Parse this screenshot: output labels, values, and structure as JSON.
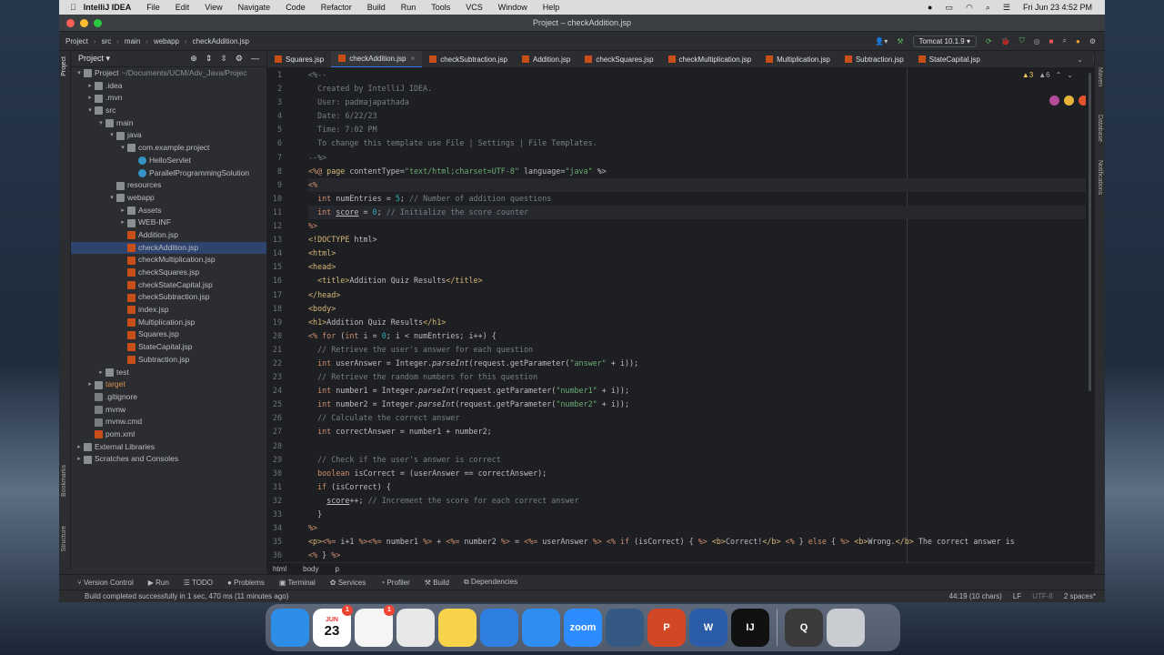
{
  "menubar": {
    "app": "IntelliJ IDEA",
    "items": [
      "File",
      "Edit",
      "View",
      "Navigate",
      "Code",
      "Refactor",
      "Build",
      "Run",
      "Tools",
      "VCS",
      "Window",
      "Help"
    ],
    "clock": "Fri Jun 23  4:52 PM"
  },
  "window_title": "Project – checkAddition.jsp",
  "breadcrumbs": [
    "Project",
    "src",
    "main",
    "webapp",
    "checkAddition.jsp"
  ],
  "run_config": "Tomcat 10.1.9",
  "project_panel": {
    "title": "Project",
    "tree": [
      {
        "label": "Project",
        "path": "~/Documents/UCM/Adv_Java/Projec",
        "depth": 0,
        "arrow": "▾",
        "icon": "folder"
      },
      {
        "label": ".idea",
        "depth": 1,
        "arrow": "▸",
        "icon": "folder"
      },
      {
        "label": ".mvn",
        "depth": 1,
        "arrow": "▸",
        "icon": "folder"
      },
      {
        "label": "src",
        "depth": 1,
        "arrow": "▾",
        "icon": "folder"
      },
      {
        "label": "main",
        "depth": 2,
        "arrow": "▾",
        "icon": "folder"
      },
      {
        "label": "java",
        "depth": 3,
        "arrow": "▾",
        "icon": "folder"
      },
      {
        "label": "com.example.project",
        "depth": 4,
        "arrow": "▾",
        "icon": "folder"
      },
      {
        "label": "HelloServlet",
        "depth": 5,
        "arrow": "",
        "icon": "cls"
      },
      {
        "label": "ParallelProgrammingSolution",
        "depth": 5,
        "arrow": "",
        "icon": "cls"
      },
      {
        "label": "resources",
        "depth": 3,
        "arrow": "",
        "icon": "folder"
      },
      {
        "label": "webapp",
        "depth": 3,
        "arrow": "▾",
        "icon": "folder"
      },
      {
        "label": "Assets",
        "depth": 4,
        "arrow": "▸",
        "icon": "folder"
      },
      {
        "label": "WEB-INF",
        "depth": 4,
        "arrow": "▸",
        "icon": "folder"
      },
      {
        "label": "Addition.jsp",
        "depth": 4,
        "arrow": "",
        "icon": "jsp"
      },
      {
        "label": "checkAddition.jsp",
        "depth": 4,
        "arrow": "",
        "icon": "jsp",
        "selected": true
      },
      {
        "label": "checkMultiplication.jsp",
        "depth": 4,
        "arrow": "",
        "icon": "jsp"
      },
      {
        "label": "checkSquares.jsp",
        "depth": 4,
        "arrow": "",
        "icon": "jsp"
      },
      {
        "label": "checkStateCapital.jsp",
        "depth": 4,
        "arrow": "",
        "icon": "jsp"
      },
      {
        "label": "checkSubtraction.jsp",
        "depth": 4,
        "arrow": "",
        "icon": "jsp"
      },
      {
        "label": "index.jsp",
        "depth": 4,
        "arrow": "",
        "icon": "jsp"
      },
      {
        "label": "Multiplication.jsp",
        "depth": 4,
        "arrow": "",
        "icon": "jsp"
      },
      {
        "label": "Squares.jsp",
        "depth": 4,
        "arrow": "",
        "icon": "jsp"
      },
      {
        "label": "StateCapital.jsp",
        "depth": 4,
        "arrow": "",
        "icon": "jsp"
      },
      {
        "label": "Subtraction.jsp",
        "depth": 4,
        "arrow": "",
        "icon": "jsp"
      },
      {
        "label": "test",
        "depth": 2,
        "arrow": "▸",
        "icon": "folder"
      },
      {
        "label": "target",
        "depth": 1,
        "arrow": "▸",
        "icon": "folder",
        "orange": true
      },
      {
        "label": ".gitignore",
        "depth": 1,
        "arrow": "",
        "icon": "file"
      },
      {
        "label": "mvnw",
        "depth": 1,
        "arrow": "",
        "icon": "file"
      },
      {
        "label": "mvnw.cmd",
        "depth": 1,
        "arrow": "",
        "icon": "file"
      },
      {
        "label": "pom.xml",
        "depth": 1,
        "arrow": "",
        "icon": "jsp"
      },
      {
        "label": "External Libraries",
        "depth": 0,
        "arrow": "▸",
        "icon": "folder"
      },
      {
        "label": "Scratches and Consoles",
        "depth": 0,
        "arrow": "▸",
        "icon": "folder"
      }
    ]
  },
  "tabs": [
    "Squares.jsp",
    "checkAddition.jsp",
    "checkSubtraction.jsp",
    "Addition.jsp",
    "checkSquares.jsp",
    "checkMultiplication.jsp",
    "Multiplication.jsp",
    "Subtraction.jsp",
    "StateCapital.jsp"
  ],
  "active_tab": 1,
  "inspections": {
    "warnings": "3",
    "weak": "6"
  },
  "code_lines": [
    [
      [
        "cm",
        "<%--"
      ]
    ],
    [
      [
        "cm",
        "  Created by IntelliJ IDEA."
      ]
    ],
    [
      [
        "cm",
        "  User: padmajapathada"
      ]
    ],
    [
      [
        "cm",
        "  Date: 6/22/23"
      ]
    ],
    [
      [
        "cm",
        "  Time: 7:02 PM"
      ]
    ],
    [
      [
        "cm",
        "  To change this template use File | Settings | File Templates."
      ]
    ],
    [
      [
        "cm",
        "--%>"
      ]
    ],
    [
      [
        "kw",
        "<%@ "
      ],
      [
        "tg",
        "page "
      ],
      [
        "",
        "contentType="
      ],
      [
        "str",
        "\"text/html;charset=UTF-8\""
      ],
      [
        "",
        " language="
      ],
      [
        "str",
        "\"java\""
      ],
      [
        "",
        " %>"
      ]
    ],
    [
      [
        "kw",
        "<%"
      ]
    ],
    [
      [
        "",
        "  "
      ],
      [
        "kw",
        "int "
      ],
      [
        "",
        "numEntries = "
      ],
      [
        "num",
        "5"
      ],
      [
        "",
        "; "
      ],
      [
        "cm",
        "// Number of addition questions"
      ]
    ],
    [
      [
        "",
        "  "
      ],
      [
        "kw",
        "int "
      ],
      [
        "ul",
        "score"
      ],
      [
        "",
        " = "
      ],
      [
        "num",
        "0"
      ],
      [
        "",
        "; "
      ],
      [
        "cm",
        "// Initialize the score counter"
      ]
    ],
    [
      [
        "kw",
        "%>"
      ]
    ],
    [
      [
        "tg",
        "<!DOCTYPE "
      ],
      [
        "",
        "html>"
      ]
    ],
    [
      [
        "tg",
        "<html>"
      ]
    ],
    [
      [
        "tg",
        "<head>"
      ]
    ],
    [
      [
        "",
        "  "
      ],
      [
        "tg",
        "<title>"
      ],
      [
        "",
        "Addition Quiz Results"
      ],
      [
        "tg",
        "</title>"
      ]
    ],
    [
      [
        "tg",
        "</head>"
      ]
    ],
    [
      [
        "tg",
        "<body>"
      ]
    ],
    [
      [
        "tg",
        "<h1>"
      ],
      [
        "",
        "Addition Quiz Results"
      ],
      [
        "tg",
        "</h1>"
      ]
    ],
    [
      [
        "kw",
        "<% for "
      ],
      [
        "",
        "("
      ],
      [
        "kw",
        "int "
      ],
      [
        "",
        "i = "
      ],
      [
        "num",
        "0"
      ],
      [
        "",
        "; i < numEntries; i++) {"
      ]
    ],
    [
      [
        "cm",
        "  // Retrieve the user's answer for each question"
      ]
    ],
    [
      [
        "",
        "  "
      ],
      [
        "kw",
        "int "
      ],
      [
        "",
        "userAnswer = Integer."
      ],
      [
        "it",
        "parseInt"
      ],
      [
        "",
        "(request.getParameter("
      ],
      [
        "str",
        "\"answer\""
      ],
      [
        "",
        " + i));"
      ]
    ],
    [
      [
        "cm",
        "  // Retrieve the random numbers for this question"
      ]
    ],
    [
      [
        "",
        "  "
      ],
      [
        "kw",
        "int "
      ],
      [
        "",
        "number1 = Integer."
      ],
      [
        "it",
        "parseInt"
      ],
      [
        "",
        "(request.getParameter("
      ],
      [
        "str",
        "\"number1\""
      ],
      [
        "",
        " + i));"
      ]
    ],
    [
      [
        "",
        "  "
      ],
      [
        "kw",
        "int "
      ],
      [
        "",
        "number2 = Integer."
      ],
      [
        "it",
        "parseInt"
      ],
      [
        "",
        "(request.getParameter("
      ],
      [
        "str",
        "\"number2\""
      ],
      [
        "",
        " + i));"
      ]
    ],
    [
      [
        "cm",
        "  // Calculate the correct answer"
      ]
    ],
    [
      [
        "",
        "  "
      ],
      [
        "kw",
        "int "
      ],
      [
        "",
        "correctAnswer = number1 + number2;"
      ]
    ],
    [
      [
        "",
        ""
      ]
    ],
    [
      [
        "cm",
        "  // Check if the user's answer is correct"
      ]
    ],
    [
      [
        "",
        "  "
      ],
      [
        "kw",
        "boolean "
      ],
      [
        "",
        "isCorrect = (userAnswer == correctAnswer);"
      ]
    ],
    [
      [
        "",
        "  "
      ],
      [
        "kw",
        "if "
      ],
      [
        "",
        "(isCorrect) {"
      ]
    ],
    [
      [
        "",
        "    "
      ],
      [
        "ul",
        "score"
      ],
      [
        "",
        "++; "
      ],
      [
        "cm",
        "// Increment the score for each correct answer"
      ]
    ],
    [
      [
        "",
        "  }"
      ]
    ],
    [
      [
        "kw",
        "%>"
      ]
    ],
    [
      [
        "tg",
        "<p>"
      ],
      [
        "kw",
        "<%= "
      ],
      [
        "",
        "i+1 "
      ],
      [
        "kw",
        "%>"
      ],
      [
        ". "
      ],
      [
        "kw",
        "<%= "
      ],
      [
        "",
        "number1 "
      ],
      [
        "kw",
        "%>"
      ],
      [
        "",
        " + "
      ],
      [
        "kw",
        "<%= "
      ],
      [
        "",
        "number2 "
      ],
      [
        "kw",
        "%>"
      ],
      [
        "",
        " = "
      ],
      [
        "kw",
        "<%= "
      ],
      [
        "",
        "userAnswer "
      ],
      [
        "kw",
        "%> <% if "
      ],
      [
        "",
        "(isCorrect) { "
      ],
      [
        "kw",
        "%> "
      ],
      [
        "tg",
        "<b>"
      ],
      [
        "",
        "Correct!"
      ],
      [
        "tg",
        "</b>"
      ],
      [
        "kw",
        " <% "
      ],
      [
        "",
        "} "
      ],
      [
        "kw",
        "else "
      ],
      [
        "",
        "{ "
      ],
      [
        "kw",
        "%> "
      ],
      [
        "tg",
        "<b>"
      ],
      [
        "",
        "Wrong."
      ],
      [
        "tg",
        "</b>"
      ],
      [
        "",
        " The correct answer is "
      ]
    ],
    [
      [
        "kw",
        "<% "
      ],
      [
        "",
        "} "
      ],
      [
        "kw",
        "%>"
      ]
    ]
  ],
  "editor_crumbs": [
    "html",
    "body",
    "p"
  ],
  "bottom_tools": [
    "Version Control",
    "Run",
    "TODO",
    "Problems",
    "Terminal",
    "Services",
    "Profiler",
    "Build",
    "Dependencies"
  ],
  "status": {
    "message": "Build completed successfully in 1 sec, 470 ms (11 minutes ago)",
    "position": "44:19 (10 chars)",
    "line_sep": "LF",
    "encoding": "UTF-8",
    "indent": "2 spaces*"
  },
  "side_labels": {
    "left": [
      "Project",
      "Bookmarks",
      "Structure"
    ],
    "right": [
      "Maven",
      "Database",
      "Notifications"
    ]
  },
  "dock": [
    {
      "name": "finder",
      "color": "#2d8ee8",
      "label": ""
    },
    {
      "name": "calendar",
      "color": "#ffffff",
      "label": "23",
      "sub": "JUN",
      "badge": "1"
    },
    {
      "name": "reminders",
      "color": "#f5f5f5",
      "label": "",
      "badge": "1"
    },
    {
      "name": "chrome",
      "color": "#e8e8e8",
      "label": ""
    },
    {
      "name": "notes",
      "color": "#f7d34a",
      "label": ""
    },
    {
      "name": "xcode",
      "color": "#2f7fe0",
      "label": ""
    },
    {
      "name": "appstore",
      "color": "#2e8ef2",
      "label": ""
    },
    {
      "name": "zoom",
      "color": "#2d8cff",
      "label": "zoom"
    },
    {
      "name": "mysql-workbench",
      "color": "#345a84",
      "label": ""
    },
    {
      "name": "powerpoint",
      "color": "#d24726",
      "label": "P"
    },
    {
      "name": "word",
      "color": "#2b5ca8",
      "label": "W"
    },
    {
      "name": "intellij",
      "color": "#111111",
      "label": "IJ"
    },
    {
      "name": "quicktime",
      "color": "#3a3a3a",
      "label": "Q"
    },
    {
      "name": "trash",
      "color": "#c9ccd1",
      "label": ""
    }
  ]
}
